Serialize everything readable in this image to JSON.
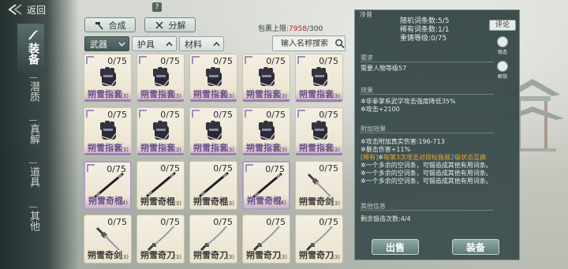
{
  "nav": {
    "back_label": "返回",
    "items": [
      {
        "label": "装备",
        "active": true
      },
      {
        "label": "潜质",
        "active": false
      },
      {
        "label": "真解",
        "active": false
      },
      {
        "label": "道具",
        "active": false
      },
      {
        "label": "其他",
        "active": false
      }
    ]
  },
  "toolbar": {
    "help_badge": "?",
    "synth_label": "合成",
    "decompose_label": "分解",
    "capacity_label": "包裹上限:",
    "capacity_current": "7958",
    "capacity_sep": "/",
    "capacity_max": "300"
  },
  "filters": {
    "weapon": "武器",
    "armor": "护具",
    "material": "材料",
    "search_placeholder": "输入名称搜索"
  },
  "items": [
    {
      "name": "朔雪指套",
      "count": "0/75",
      "level": "(3)",
      "type": "glove",
      "rarity": "purple"
    },
    {
      "name": "朔雪指套",
      "count": "0/75",
      "level": "(3)",
      "type": "glove",
      "rarity": "purple"
    },
    {
      "name": "朔雪指套",
      "count": "0/75",
      "level": "(3)",
      "type": "glove",
      "rarity": "purple"
    },
    {
      "name": "朔雪指套",
      "count": "0/75",
      "level": "(3)",
      "type": "glove",
      "rarity": "purple"
    },
    {
      "name": "朔雪指套",
      "count": "0/75",
      "level": "(3)",
      "type": "glove",
      "rarity": "purple"
    },
    {
      "name": "朔雪指套",
      "count": "0/75",
      "level": "(3)",
      "type": "glove",
      "rarity": "purple"
    },
    {
      "name": "朔雪指套",
      "count": "0/75",
      "level": "(3)",
      "type": "glove",
      "rarity": "purple"
    },
    {
      "name": "朔雪指套",
      "count": "0/75",
      "level": "(3)",
      "type": "glove",
      "rarity": "purple"
    },
    {
      "name": "朔雪指套",
      "count": "0/75",
      "level": "(3)",
      "type": "glove",
      "rarity": "purple"
    },
    {
      "name": "朔雪指套",
      "count": "0/75",
      "level": "(3)",
      "type": "glove",
      "rarity": "purple"
    },
    {
      "name": "朔雪奇棍",
      "count": "0/75",
      "level": "(4)",
      "type": "staff",
      "rarity": "purple"
    },
    {
      "name": "朔雪奇棍",
      "count": "0/75",
      "level": "(3)",
      "type": "staff",
      "rarity": "plain"
    },
    {
      "name": "朔雪奇棍",
      "count": "0/75",
      "level": "(3)",
      "type": "staff",
      "rarity": "plain"
    },
    {
      "name": "朔雪奇棍",
      "count": "0/75",
      "level": "(4)",
      "type": "staff",
      "rarity": "purple"
    },
    {
      "name": "朔雪奇剑",
      "count": "0/75",
      "level": "(3)",
      "type": "sword",
      "rarity": "plain"
    },
    {
      "name": "朔雪奇剑",
      "count": "0/75",
      "level": "(3)",
      "type": "sword",
      "rarity": "plain"
    },
    {
      "name": "朔雪奇刀",
      "count": "0/75",
      "level": "(3)",
      "type": "blade",
      "rarity": "plain"
    },
    {
      "name": "朔雪奇刀",
      "count": "0/75",
      "level": "(3)",
      "type": "blade",
      "rarity": "plain"
    },
    {
      "name": "朔雪奇刀",
      "count": "0/75",
      "level": "(3)",
      "type": "blade",
      "rarity": "plain"
    },
    {
      "name": "朔雪奇刀",
      "count": "0/75",
      "level": "(3)",
      "type": "blade",
      "rarity": "plain"
    }
  ],
  "detail": {
    "top_label": "冷昔",
    "stat_lines": [
      "随机词条数:5/5",
      "稀有词条数:1/1",
      "重铸等级:0/75"
    ],
    "comment_label": "评论",
    "forge_label": "锻造",
    "unlock_label": "解锁",
    "req_title": "需求",
    "req_text": "需要人物等级57",
    "effect_title": "效果",
    "effect_lines": [
      "非拳掌系武学攻击强度降低35%",
      "攻击+2100"
    ],
    "extra_title": "附加效果",
    "extra_lines": [
      {
        "prefix": "",
        "text": "攻击附加真实伤害:196-713"
      },
      {
        "prefix": "",
        "text": "暴击伤害+11%"
      }
    ],
    "rare_tag": "[稀有]",
    "rare_text_a": "每第3次攻击对目标施展",
    "rare_num": "2",
    "rare_text_b": "级状态互换",
    "empty_lines": [
      "一个多余的空词条，可锻造成其他有用词条。",
      "一个多余的空词条，可锻造成其他有用词条。",
      "一个多余的空词条，可锻造成其他有用词条。"
    ],
    "other_title": "其他信息",
    "remain_text": "剩余锻造次数:4/4",
    "sell_label": "出售",
    "equip_label": "装备"
  }
}
